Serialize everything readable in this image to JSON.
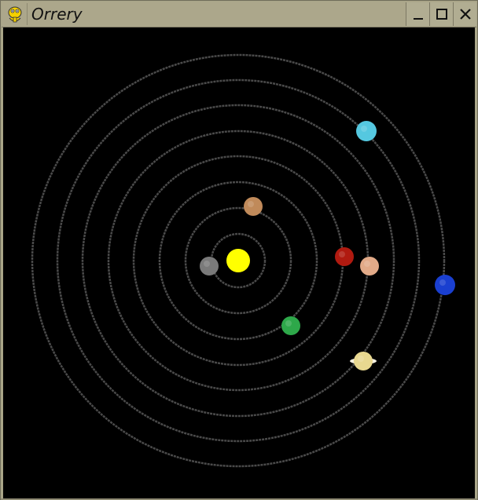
{
  "window": {
    "title": "Orrery",
    "app_icon": "python-snake-icon",
    "controls": {
      "minimize_icon": "minimize-icon",
      "maximize_icon": "maximize-icon",
      "close_icon": "close-icon"
    }
  },
  "orrery": {
    "background_color": "#000000",
    "orbit_color": "#4a4a4a",
    "sun": {
      "name": "sun",
      "color": "#ffff00"
    },
    "planets": [
      {
        "name": "mercury",
        "color": "#7a7a7a",
        "orbit": 1
      },
      {
        "name": "venus",
        "color": "#c08a5a",
        "orbit": 2
      },
      {
        "name": "earth",
        "color": "#2ea84a",
        "orbit": 3
      },
      {
        "name": "mars",
        "color": "#b01a10",
        "orbit": 4
      },
      {
        "name": "jupiter",
        "color": "#e2aa88",
        "orbit": 5
      },
      {
        "name": "saturn",
        "color": "#e8d890",
        "orbit": 6
      },
      {
        "name": "uranus",
        "color": "#55c8e0",
        "orbit": 7
      },
      {
        "name": "neptune",
        "color": "#1a3fd0",
        "orbit": 8
      }
    ],
    "orbit_count": 8
  }
}
